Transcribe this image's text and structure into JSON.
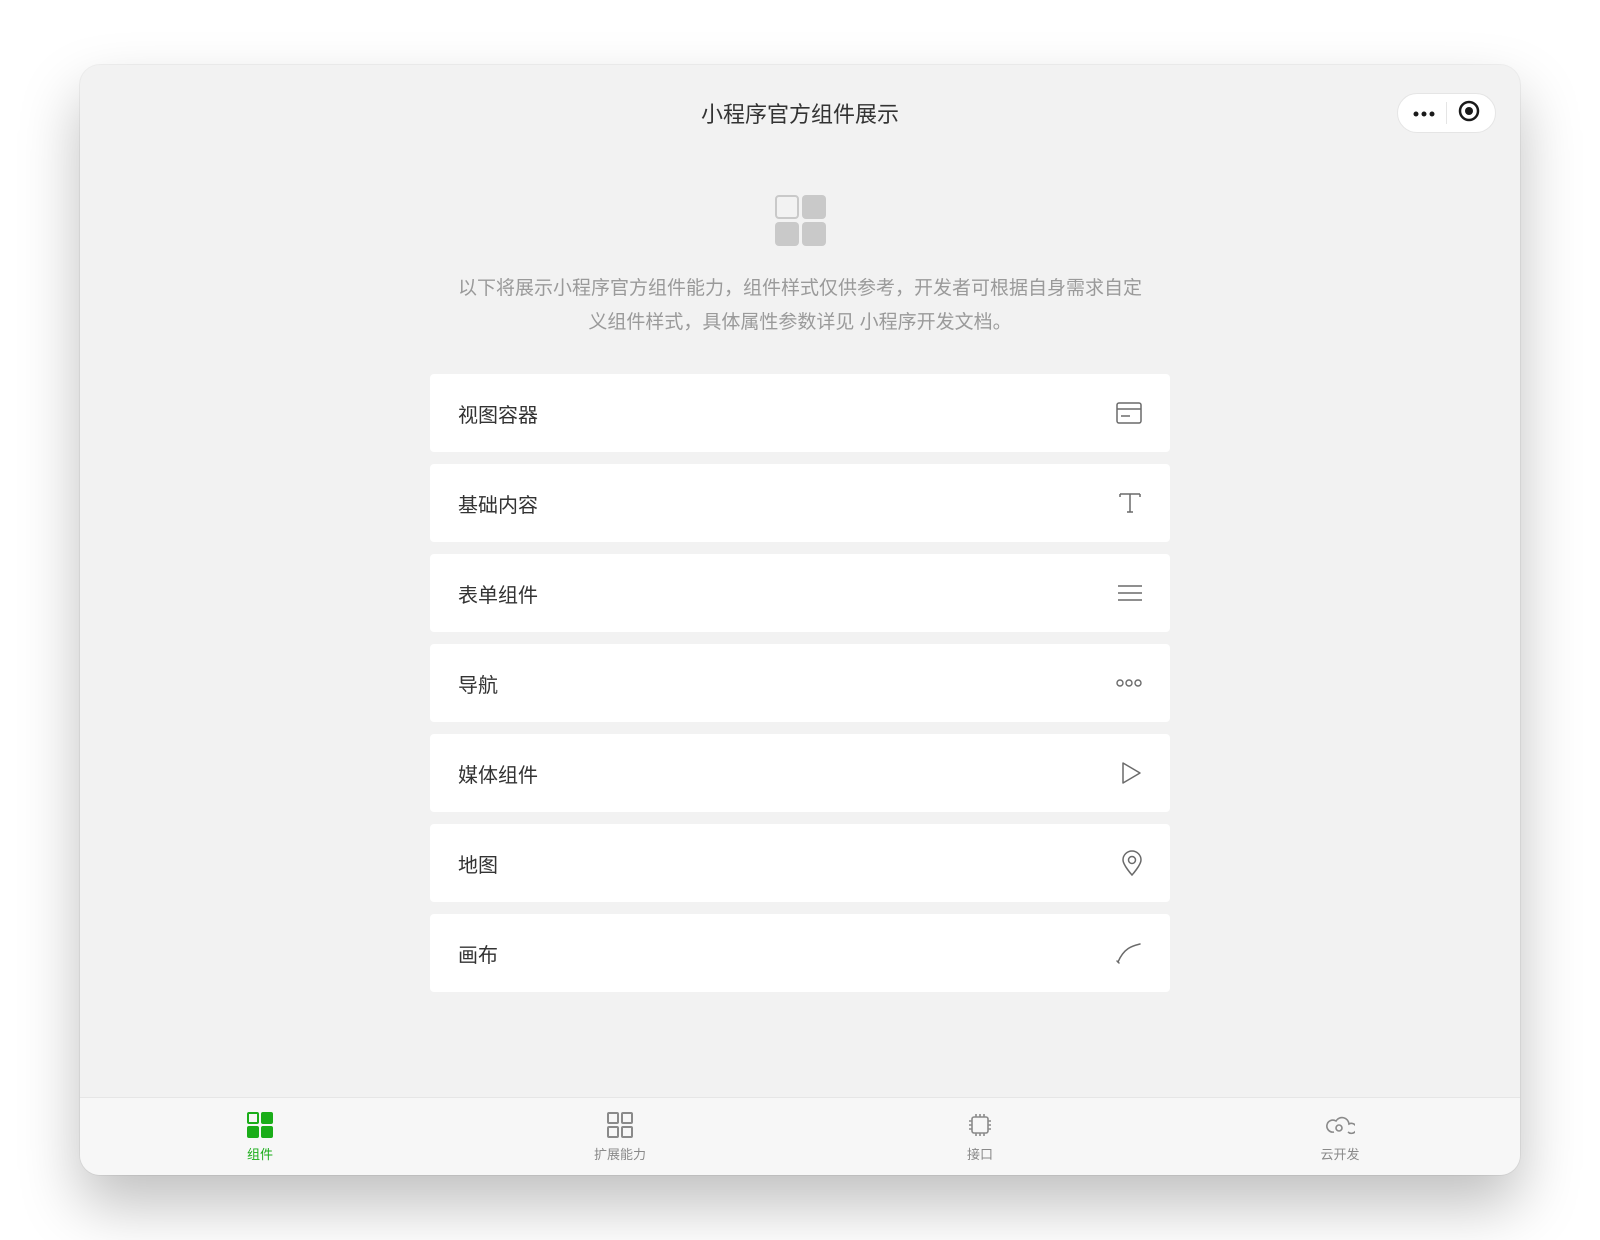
{
  "header": {
    "title": "小程序官方组件展示"
  },
  "intro": {
    "text": "以下将展示小程序官方组件能力，组件样式仅供参考，开发者可根据自身需求自定义组件样式，具体属性参数详见 小程序开发文档。"
  },
  "list": {
    "items": [
      {
        "label": "视图容器",
        "icon": "container-icon"
      },
      {
        "label": "基础内容",
        "icon": "text-icon"
      },
      {
        "label": "表单组件",
        "icon": "form-icon"
      },
      {
        "label": "导航",
        "icon": "nav-icon"
      },
      {
        "label": "媒体组件",
        "icon": "media-icon"
      },
      {
        "label": "地图",
        "icon": "map-icon"
      },
      {
        "label": "画布",
        "icon": "canvas-icon"
      }
    ]
  },
  "tabbar": {
    "items": [
      {
        "label": "组件",
        "active": true
      },
      {
        "label": "扩展能力",
        "active": false
      },
      {
        "label": "接口",
        "active": false
      },
      {
        "label": "云开发",
        "active": false
      }
    ]
  }
}
